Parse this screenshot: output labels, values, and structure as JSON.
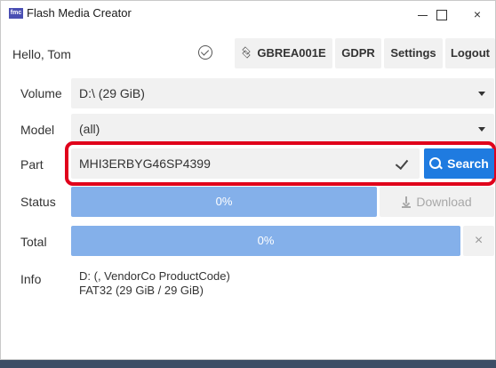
{
  "window": {
    "title": "Flash Media Creator",
    "logo_text": "fmc",
    "minimize_symbol": "",
    "maximize_symbol": "",
    "close_symbol": "×"
  },
  "header": {
    "greeting": "Hello, Tom",
    "id_button": "GBREA001E",
    "gdpr_button": "GDPR",
    "settings_button": "Settings",
    "logout_button": "Logout"
  },
  "form": {
    "volume": {
      "label": "Volume",
      "value": "D:\\ (29 GiB)"
    },
    "model": {
      "label": "Model",
      "value": "(all)"
    },
    "part": {
      "label": "Part",
      "value": "MHI3ERBYG46SP4399",
      "search_label": "Search"
    },
    "status": {
      "label": "Status",
      "progress_text": "0%",
      "progress": 0,
      "download_label": "Download"
    },
    "total": {
      "label": "Total",
      "progress_text": "0%",
      "progress": 0,
      "cancel_symbol": "×"
    },
    "info": {
      "label": "Info",
      "line1": "D: (, VendorCo ProductCode)",
      "line2": "FAT32 (29 GiB / 29 GiB)"
    }
  },
  "colors": {
    "accent": "#1f7be0",
    "progress": "#84b0ea",
    "highlight": "#e0001b"
  }
}
